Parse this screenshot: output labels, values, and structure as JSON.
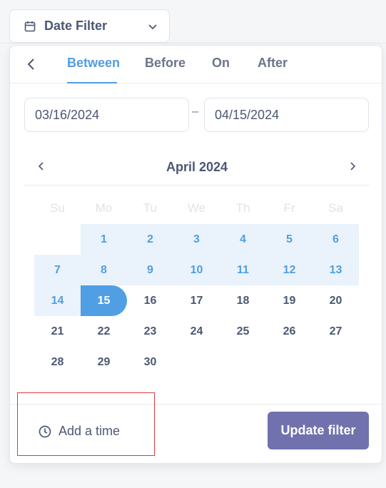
{
  "filter_button": {
    "label": "Date Filter",
    "icon": "calendar-icon"
  },
  "tabs": [
    {
      "label": "Between"
    },
    {
      "label": "Before"
    },
    {
      "label": "On"
    },
    {
      "label": "After"
    }
  ],
  "active_tab": "Between",
  "range": {
    "start": "03/16/2024",
    "separator": "–",
    "end": "04/15/2024"
  },
  "calendar": {
    "month_label": "April 2024",
    "weekdays": [
      "Su",
      "Mo",
      "Tu",
      "We",
      "Th",
      "Fr",
      "Sa"
    ],
    "weeks": [
      [
        "",
        "1",
        "2",
        "3",
        "4",
        "5",
        "6"
      ],
      [
        "7",
        "8",
        "9",
        "10",
        "11",
        "12",
        "13"
      ],
      [
        "14",
        "15",
        "16",
        "17",
        "18",
        "19",
        "20"
      ],
      [
        "21",
        "22",
        "23",
        "24",
        "25",
        "26",
        "27"
      ],
      [
        "28",
        "29",
        "30",
        "",
        "",
        "",
        ""
      ]
    ],
    "selected_end_day": "15"
  },
  "footer": {
    "add_time_label": "Add a time",
    "update_label": "Update filter"
  },
  "colors": {
    "accent": "#509ee3",
    "range_bg": "#eaf3fb",
    "primary_button": "#7172ad",
    "highlight": "#e0383e"
  }
}
